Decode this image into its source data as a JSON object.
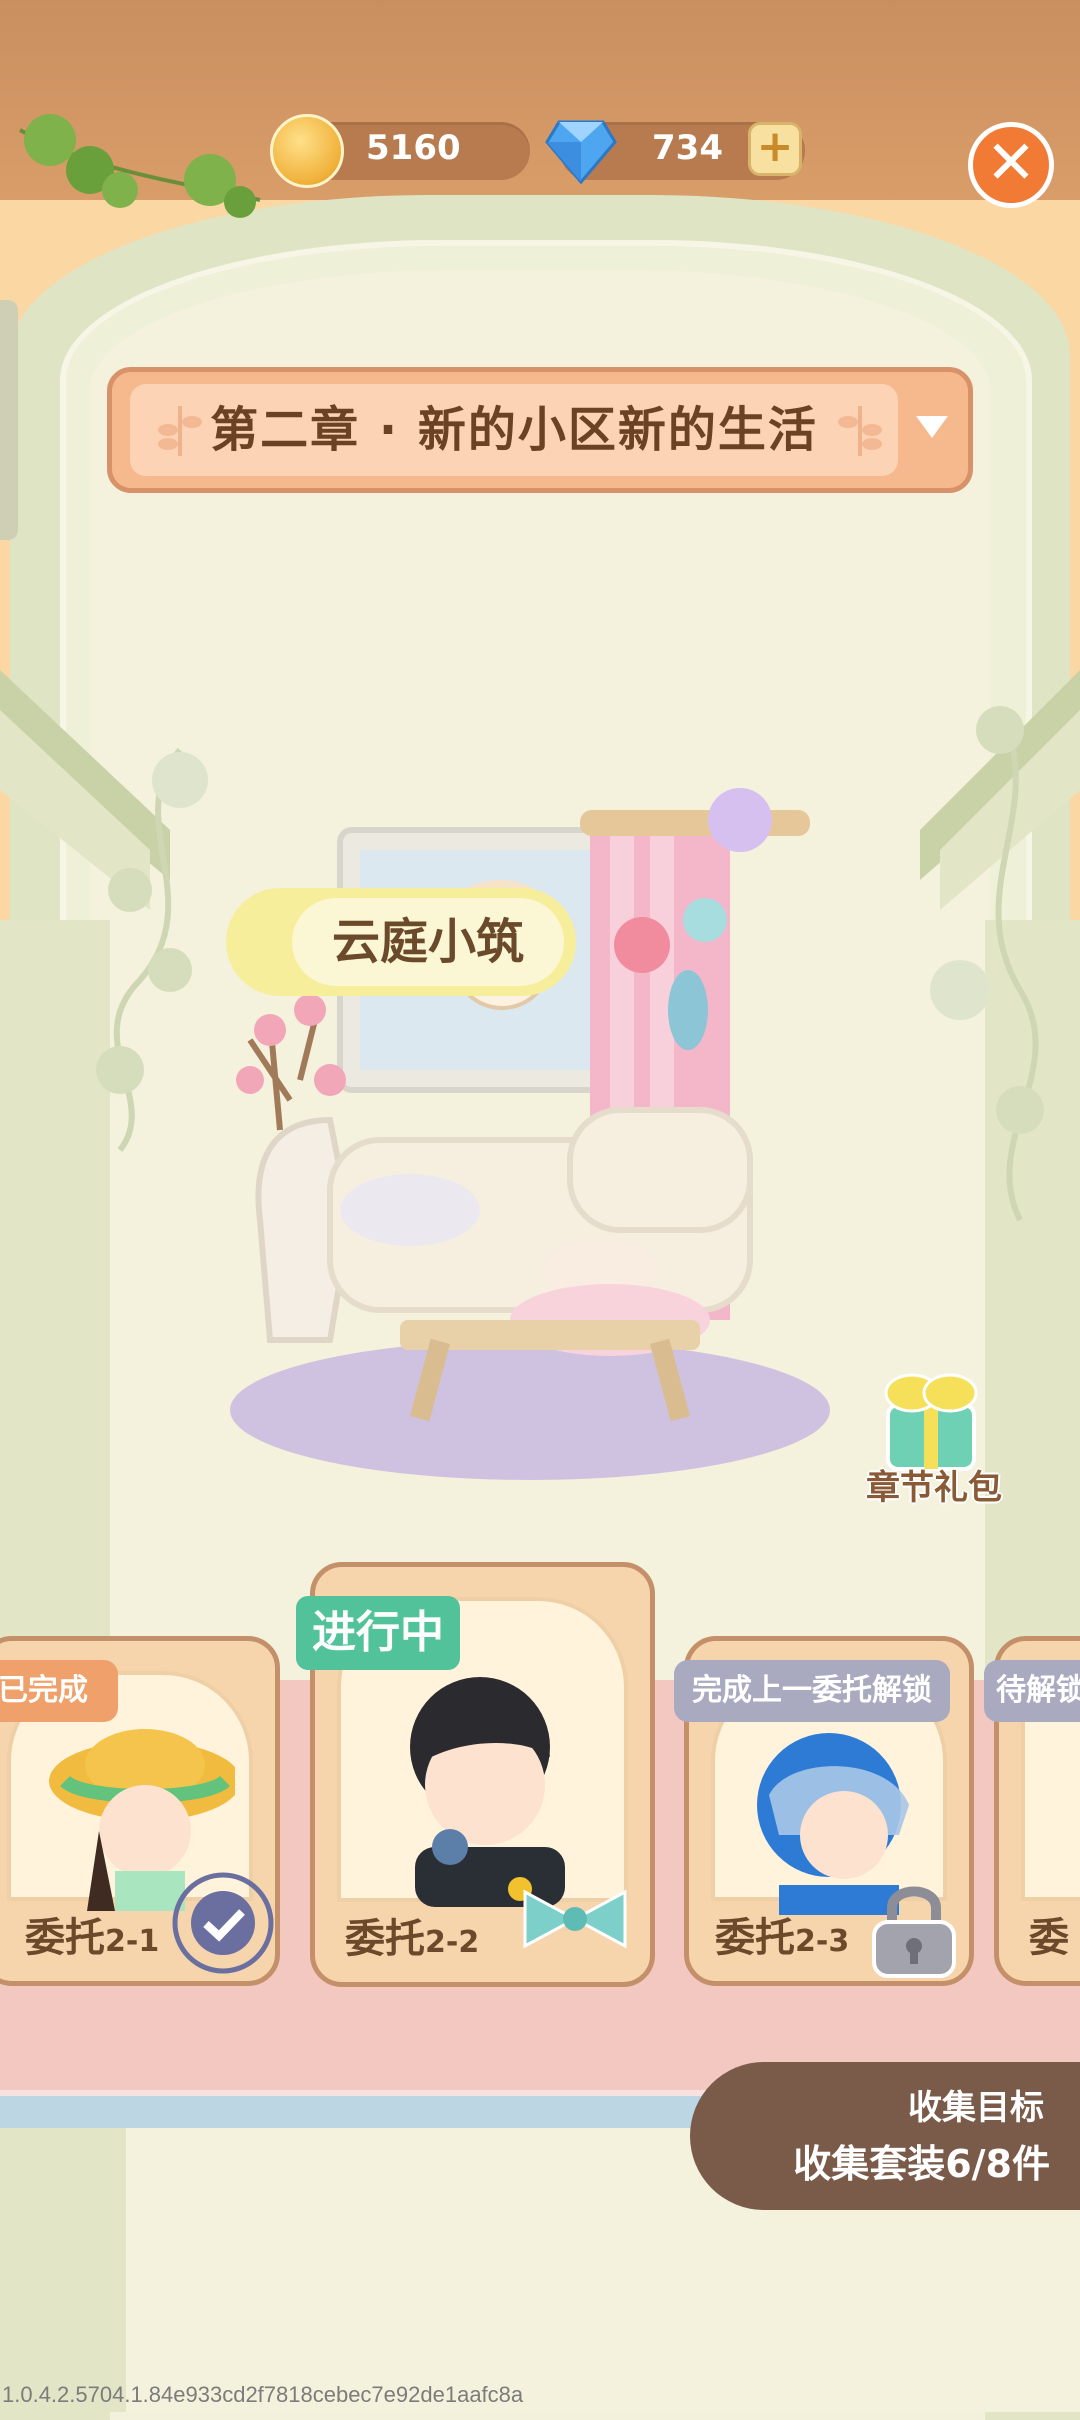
{
  "header": {
    "coins": "5160",
    "gems": "734",
    "add_icon": "plus-icon",
    "close_icon": "close-icon"
  },
  "chapter": {
    "title": "第二章 · 新的小区新的生活"
  },
  "location": {
    "name": "云庭小筑"
  },
  "gift": {
    "label": "章节礼包"
  },
  "commissions": [
    {
      "label": "委托",
      "number": "2-1",
      "status": "已完成"
    },
    {
      "label": "委托",
      "number": "2-2",
      "status": "进行中"
    },
    {
      "label": "委托",
      "number": "2-3",
      "status": "完成上一委托解锁"
    },
    {
      "label": "委",
      "number": "",
      "status": "待解锁"
    }
  ],
  "goal": {
    "title": "收集目标",
    "progress": "收集套装6/8件"
  },
  "version": "1.0.4.2.5704.1.84e933cd2f7818cebec7e92de1aafc8a",
  "colors": {
    "accent": "#f17b35",
    "banner": "#f6b98d",
    "in_progress": "#52c29a",
    "locked": "#a9a9c0"
  }
}
